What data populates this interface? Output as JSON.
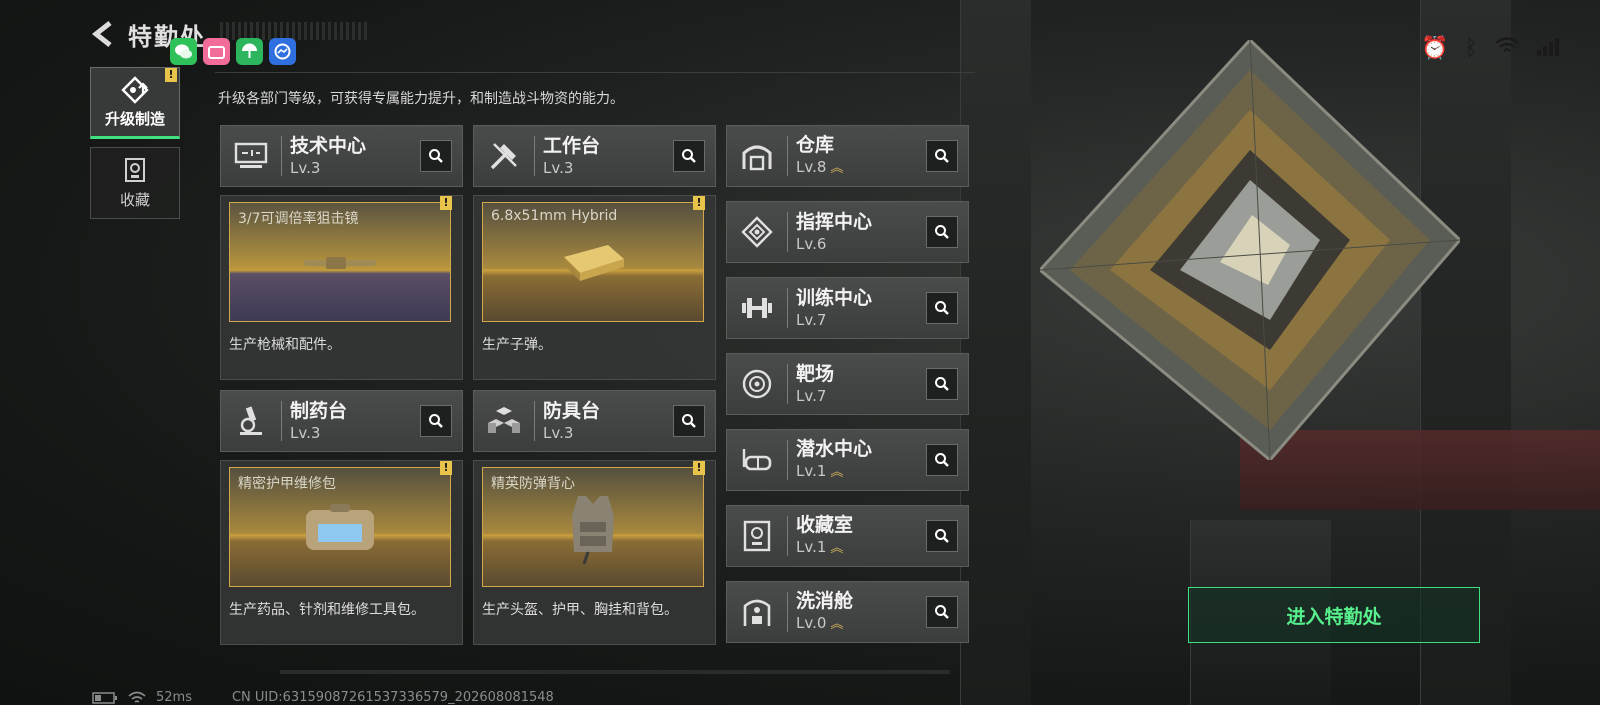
{
  "header": {
    "title": "特勤处"
  },
  "app_icons": [
    {
      "name": "wechat-app-icon",
      "color": "#2fc25b"
    },
    {
      "name": "bilibili-app-icon",
      "color": "#f26c9a"
    },
    {
      "name": "umbrella-app-icon",
      "color": "#2db55d"
    },
    {
      "name": "messenger-app-icon",
      "color": "#2f6fe0"
    }
  ],
  "sidebar": {
    "tabs": [
      {
        "label": "升级制造",
        "badge": "!",
        "icon": "upgrade-icon"
      },
      {
        "label": "收藏",
        "icon": "collection-icon"
      }
    ]
  },
  "description": "升级各部门等级，可获得专属能力提升，和制造战斗物资的能力。",
  "production": [
    {
      "name": "技术中心",
      "level": "Lv.3",
      "icon": "computer-icon",
      "item": "3/7可调倍率狙击镜",
      "badge": "!",
      "desc": "生产枪械和配件。"
    },
    {
      "name": "工作台",
      "level": "Lv.3",
      "icon": "tools-icon",
      "item": "6.8x51mm Hybrid",
      "badge": "!",
      "desc": "生产子弹。"
    },
    {
      "name": "制药台",
      "level": "Lv.3",
      "icon": "microscope-icon",
      "item": "精密护甲维修包",
      "badge": "!",
      "desc": "生产药品、针剂和维修工具包。"
    },
    {
      "name": "防具台",
      "level": "Lv.3",
      "icon": "armor-boxes-icon",
      "item": "精英防弹背心",
      "badge": "!",
      "desc": "生产头盔、护甲、胸挂和背包。"
    }
  ],
  "facilities": [
    {
      "name": "仓库",
      "level": "Lv.8",
      "up": "︽",
      "icon": "warehouse-icon"
    },
    {
      "name": "指挥中心",
      "level": "Lv.6",
      "up": "",
      "icon": "command-icon"
    },
    {
      "name": "训练中心",
      "level": "Lv.7",
      "up": "",
      "icon": "dumbbell-icon"
    },
    {
      "name": "靶场",
      "level": "Lv.7",
      "up": "",
      "icon": "target-icon"
    },
    {
      "name": "潜水中心",
      "level": "Lv.1",
      "up": "︽",
      "icon": "diving-mask-icon"
    },
    {
      "name": "收藏室",
      "level": "Lv.1",
      "up": "︽",
      "icon": "trophy-case-icon"
    },
    {
      "name": "洗消舱",
      "level": "Lv.0",
      "up": "︽",
      "icon": "decon-icon"
    }
  ],
  "enter_button": "进入特勤处",
  "footer": {
    "ping": "52ms",
    "uid": "CN UID:631590872615373365​79_202608081548"
  }
}
